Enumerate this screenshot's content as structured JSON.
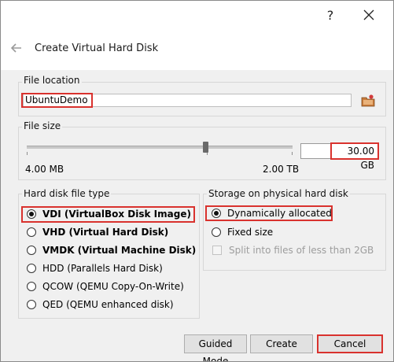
{
  "titlebar": {
    "help_icon": "question-mark-icon",
    "close_icon": "close-icon"
  },
  "wizard": {
    "title": "Create Virtual Hard Disk",
    "back_icon": "back-arrow-icon"
  },
  "file_location": {
    "group_label": "File location",
    "value": "UbuntuDemo",
    "folder_icon": "folder-browse-icon"
  },
  "file_size": {
    "group_label": "File size",
    "min_label": "4.00 MB",
    "max_label": "2.00 TB",
    "value": "30.00 GB",
    "slider_position_fraction": 0.68
  },
  "disk_type": {
    "group_label": "Hard disk file type",
    "options": [
      {
        "label": "VDI (VirtualBox Disk Image)",
        "selected": true,
        "bold": true
      },
      {
        "label": "VHD (Virtual Hard Disk)",
        "selected": false,
        "bold": true
      },
      {
        "label": "VMDK (Virtual Machine Disk)",
        "selected": false,
        "bold": true
      },
      {
        "label": "HDD (Parallels Hard Disk)",
        "selected": false,
        "bold": false
      },
      {
        "label": "QCOW (QEMU Copy-On-Write)",
        "selected": false,
        "bold": false
      },
      {
        "label": "QED (QEMU enhanced disk)",
        "selected": false,
        "bold": false
      }
    ]
  },
  "storage": {
    "group_label": "Storage on physical hard disk",
    "options": [
      {
        "label": "Dynamically allocated",
        "selected": true
      },
      {
        "label": "Fixed size",
        "selected": false
      }
    ],
    "split_label": "Split into files of less than 2GB",
    "split_checked": false,
    "split_enabled": false
  },
  "buttons": {
    "guided": "Guided Mode",
    "create": "Create",
    "cancel": "Cancel"
  },
  "colors": {
    "highlight": "#d9322e",
    "background": "#f0f0f0"
  }
}
